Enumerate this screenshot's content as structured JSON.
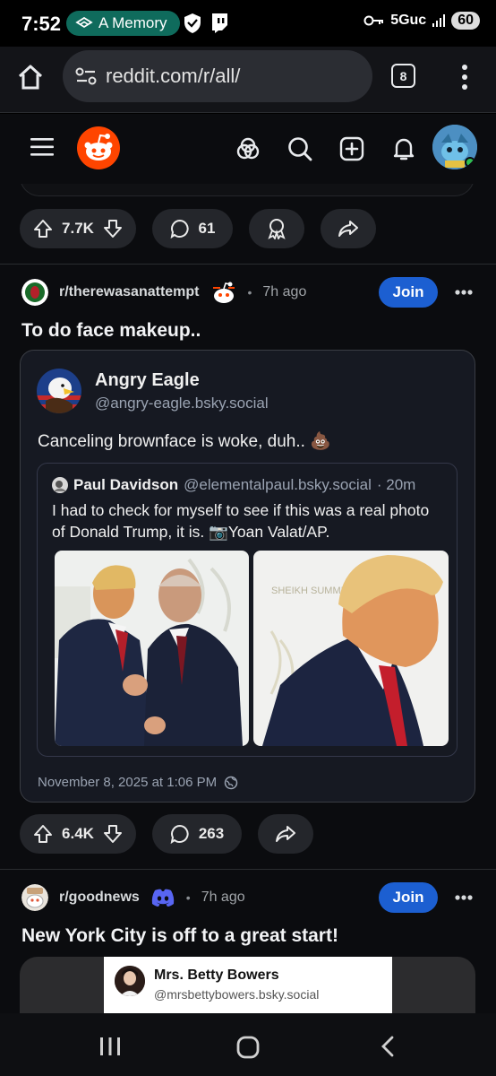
{
  "status_bar": {
    "time": "7:52",
    "memory_pill": "A Memory",
    "network": "5Guc",
    "battery": "60"
  },
  "browser": {
    "url": "reddit.com/r/all/",
    "tab_count": "8"
  },
  "posts": [
    {
      "upvotes": "7.7K",
      "comments": "61"
    },
    {
      "subreddit": "r/therewasanattempt",
      "age": "7h ago",
      "join_label": "Join",
      "title": "To do face makeup..",
      "embed": {
        "author_name": "Angry Eagle",
        "author_handle": "@angry-eagle.bsky.social",
        "text": "Canceling brownface is woke, duh.. 💩",
        "quote": {
          "author_name": "Paul Davidson",
          "author_handle": "@elementalpaul.bsky.social",
          "age": "· 20m",
          "text": "I had to check for myself to see if this was a real photo of Donald Trump, it is. 📷Yoan Valat/AP."
        },
        "date": "November 8, 2025 at 1:06 PM"
      },
      "upvotes": "6.4K",
      "comments": "263"
    },
    {
      "subreddit": "r/goodnews",
      "age": "7h ago",
      "join_label": "Join",
      "title": "New York City is off to a great start!",
      "preview": {
        "author_name": "Mrs. Betty Bowers",
        "author_handle": "@mrsbettybowers.bsky.social"
      }
    }
  ],
  "colors": {
    "join_blue": "#1c5fd1",
    "reddit_orange": "#ff4500",
    "pill_bg": "#24262b"
  }
}
